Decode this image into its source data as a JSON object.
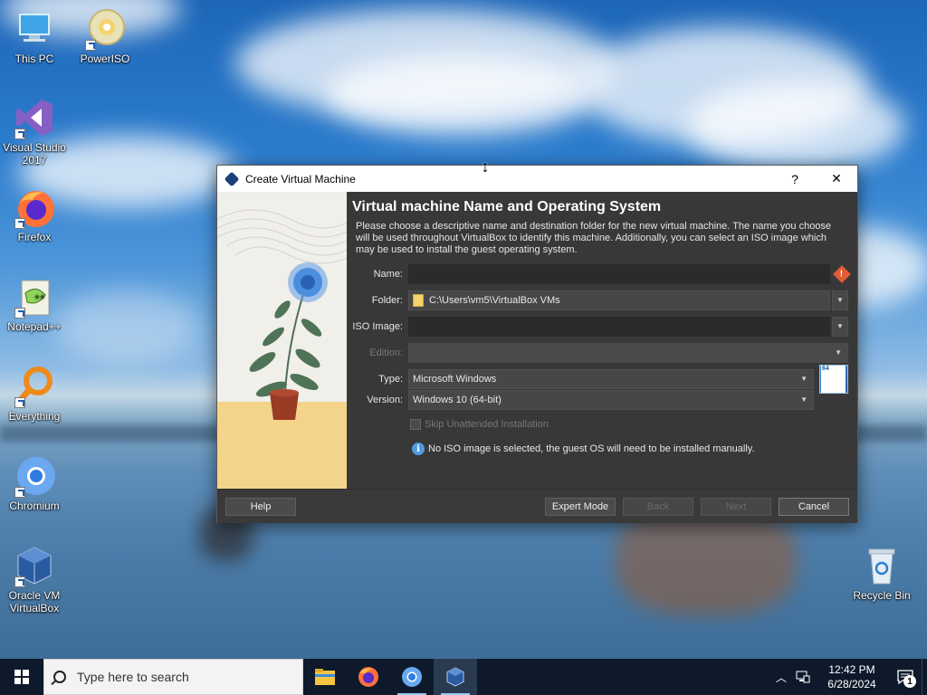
{
  "desktop": {
    "icons": [
      {
        "label": "This PC",
        "icon": "computer-icon"
      },
      {
        "label": "PowerISO",
        "icon": "disc-icon"
      },
      {
        "label": "Visual Studio 2017",
        "icon": "visual-studio-icon"
      },
      {
        "label": "Firefox",
        "icon": "firefox-icon"
      },
      {
        "label": "Notepad++",
        "icon": "notepad-plus-plus-icon"
      },
      {
        "label": "Everything",
        "icon": "search-magnifier-icon"
      },
      {
        "label": "Chromium",
        "icon": "chromium-icon"
      },
      {
        "label": "Oracle VM VirtualBox",
        "icon": "virtualbox-icon"
      },
      {
        "label": "Recycle Bin",
        "icon": "recycle-bin-icon"
      }
    ]
  },
  "dialog": {
    "title": "Create Virtual Machine",
    "help_glyph": "?",
    "close_glyph": "✕",
    "heading": "Virtual machine Name and Operating System",
    "description": "Please choose a descriptive name and destination folder for the new virtual machine. The name you choose will be used throughout VirtualBox to identify this machine. Additionally, you can select an ISO image which may be used to install the guest operating system.",
    "fields": {
      "name_label": "Name:",
      "name_value": "",
      "folder_label": "Folder:",
      "folder_value": "C:\\Users\\vm5\\VirtualBox VMs",
      "iso_label": "ISO Image:",
      "iso_value": "",
      "edition_label": "Edition:",
      "edition_value": "",
      "type_label": "Type:",
      "type_value": "Microsoft Windows",
      "version_label": "Version:",
      "version_value": "Windows 10 (64-bit)",
      "os_badge_text": "10",
      "os_badge_bits": "64"
    },
    "skip_unattended_label": "Skip Unattended Installation",
    "info_text": "No ISO image is selected, the guest OS will need to be installed manually.",
    "buttons": {
      "help": "Help",
      "expert_mode": "Expert Mode",
      "back": "Back",
      "next": "Next",
      "cancel": "Cancel"
    }
  },
  "taskbar": {
    "search_placeholder": "Type here to search",
    "apps": [
      "file-explorer-icon",
      "firefox-icon",
      "chromium-icon",
      "virtualbox-icon"
    ],
    "time": "12:42 PM",
    "date": "6/28/2024",
    "notification_count": "1"
  },
  "colors": {
    "dialog_bg": "#383838",
    "taskbar_bg": "#0e1a2b",
    "accent_blue": "#4f9be0",
    "warning_orange": "#e35a35"
  }
}
